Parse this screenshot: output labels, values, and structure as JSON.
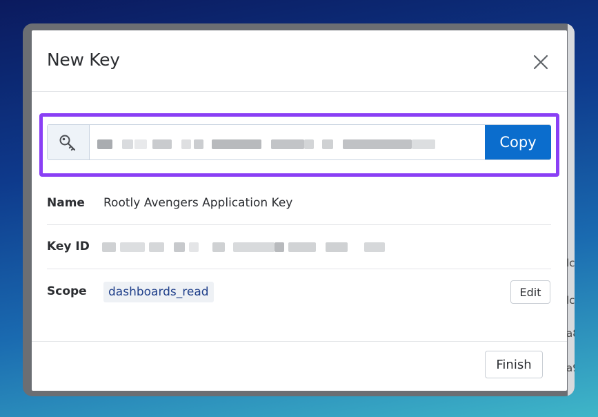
{
  "dialog": {
    "title": "New Key",
    "close_icon": "close-icon"
  },
  "key_field": {
    "icon": "key-icon",
    "value_redacted": true,
    "copy_label": "Copy",
    "highlight_color": "#8a3ff5"
  },
  "details": {
    "name_label": "Name",
    "name_value": "Rootly Avengers Application Key",
    "key_id_label": "Key ID",
    "key_id_redacted": true,
    "scope_label": "Scope",
    "scope_value": "dashboards_read",
    "edit_label": "Edit"
  },
  "footer": {
    "finish_label": "Finish"
  },
  "background_partial_text": [
    "lc",
    "lc",
    "a8",
    "a9"
  ],
  "colors": {
    "primary": "#0b6dcd",
    "highlight": "#8a3ff5",
    "chip_text": "#1f3f8a"
  }
}
